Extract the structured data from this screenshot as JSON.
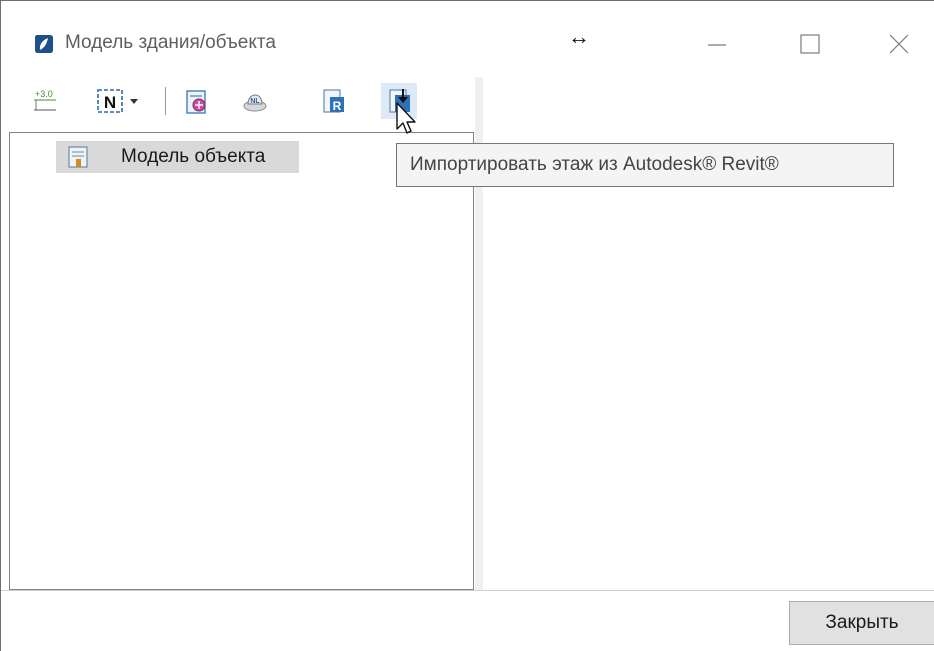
{
  "window": {
    "title": "Модель здания/объекта",
    "resize_glyph": "↔",
    "buttons": [
      "minimize",
      "maximize",
      "close"
    ]
  },
  "toolbar": {
    "items": [
      {
        "icon": "level-elevation-icon",
        "label": "+3.0"
      },
      {
        "icon": "north-arrow-dropdown-icon",
        "label": "N"
      },
      {
        "icon": "floor-settings-icon"
      },
      {
        "icon": "cloud-sync-icon"
      },
      {
        "icon": "revit-export-icon",
        "label": "R"
      },
      {
        "icon": "revit-import-floor-icon"
      }
    ]
  },
  "tree": {
    "items": [
      {
        "label": "Модель объекта",
        "icon": "building-model-icon",
        "selected": true
      }
    ]
  },
  "tooltip": {
    "text": "Импортировать этаж из Autodesk® Revit®"
  },
  "footer": {
    "close_label": "Закрыть"
  },
  "colors": {
    "accent": "#1e72c8",
    "selection": "#d9d9d9",
    "hover": "#dde9f6"
  }
}
